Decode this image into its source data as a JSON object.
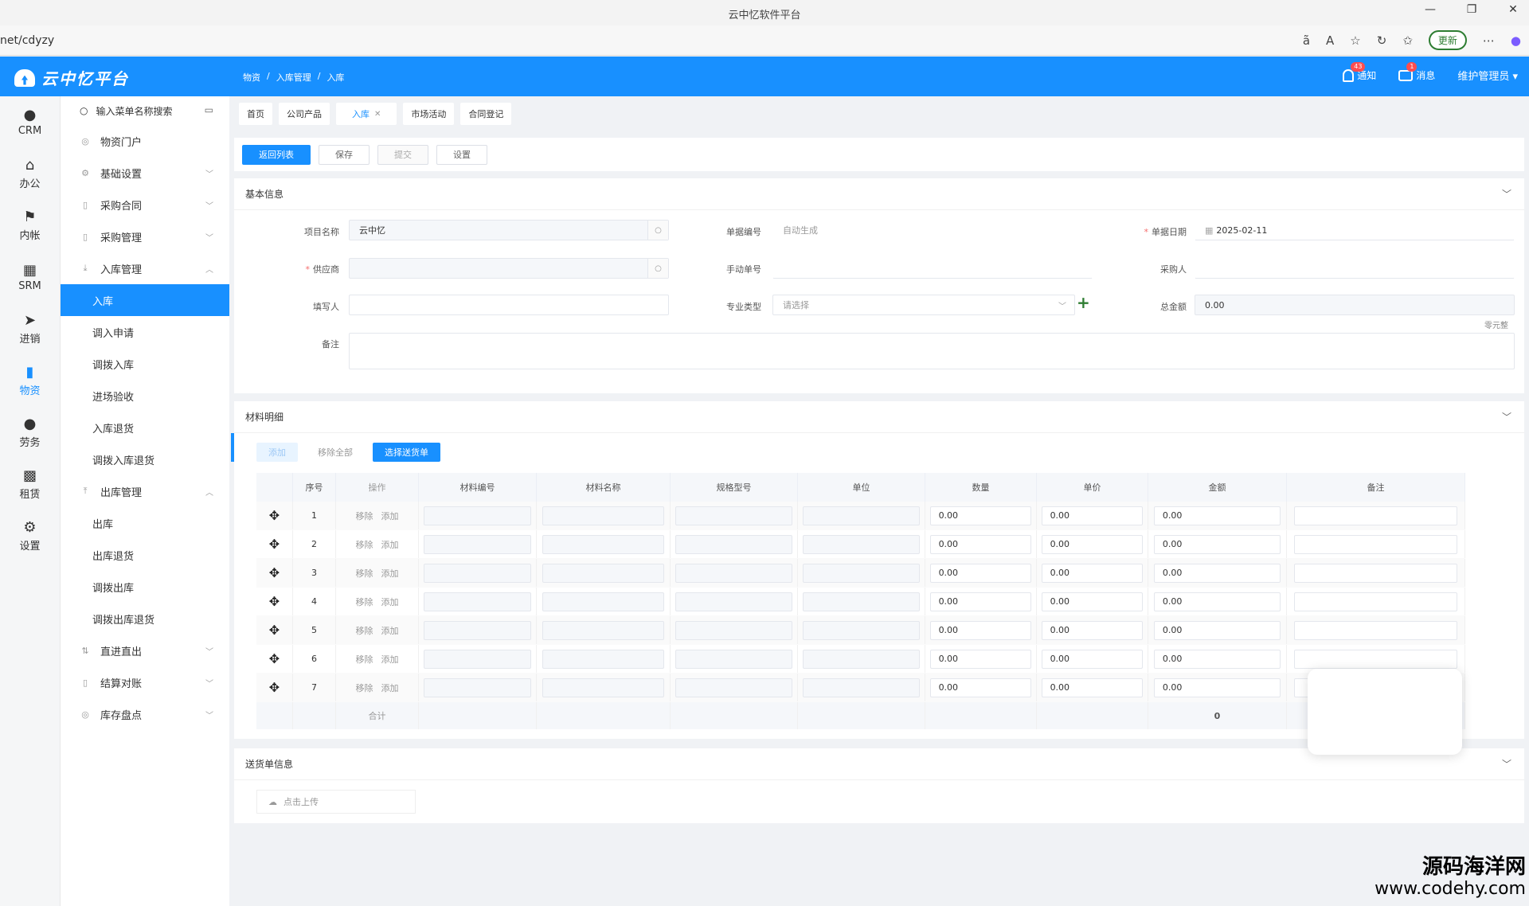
{
  "browser": {
    "title": "云中忆软件平台",
    "url": "net/cdyzy",
    "update_label": "更新"
  },
  "header": {
    "logo": "云中忆平台",
    "breadcrumb": [
      "物资",
      "/",
      "入库管理",
      "/",
      "入库"
    ],
    "notify_label": "通知",
    "notify_count": "43",
    "message_label": "消息",
    "message_count": "1",
    "user": "维护管理员 ▾"
  },
  "iconbar": [
    {
      "label": "CRM",
      "icon": "user-icon"
    },
    {
      "label": "办公",
      "icon": "home-icon"
    },
    {
      "label": "内帐",
      "icon": "flag-icon"
    },
    {
      "label": "SRM",
      "icon": "grid-icon"
    },
    {
      "label": "进销",
      "icon": "send-icon"
    },
    {
      "label": "物资",
      "icon": "book-icon"
    },
    {
      "label": "劳务",
      "icon": "person-icon"
    },
    {
      "label": "租赁",
      "icon": "apps-icon"
    },
    {
      "label": "设置",
      "icon": "gear-icon"
    }
  ],
  "menu": {
    "search_placeholder": "输入菜单名称搜索",
    "items": [
      {
        "label": "物资门户"
      },
      {
        "label": "基础设置"
      },
      {
        "label": "采购合同"
      },
      {
        "label": "采购管理"
      },
      {
        "label": "入库管理"
      },
      {
        "label": "入库"
      },
      {
        "label": "调入申请"
      },
      {
        "label": "调拨入库"
      },
      {
        "label": "进场验收"
      },
      {
        "label": "入库退货"
      },
      {
        "label": "调拨入库退货"
      },
      {
        "label": "出库管理"
      },
      {
        "label": "出库"
      },
      {
        "label": "出库退货"
      },
      {
        "label": "调拨出库"
      },
      {
        "label": "调拨出库退货"
      },
      {
        "label": "直进直出"
      },
      {
        "label": "结算对账"
      },
      {
        "label": "库存盘点"
      }
    ]
  },
  "tabs": [
    "首页",
    "公司产品",
    "入库",
    "市场活动",
    "合同登记"
  ],
  "actions": {
    "back": "返回列表",
    "save": "保存",
    "submit": "提交",
    "settings": "设置"
  },
  "basic": {
    "title": "基本信息",
    "project_label": "项目名称",
    "project_value": "云中忆",
    "docno_label": "单据编号",
    "docno_value": "自动生成",
    "date_label": "单据日期",
    "date_value": "2025-02-11",
    "supplier_label": "供应商",
    "manual_label": "手动单号",
    "buyer_label": "采购人",
    "filler_label": "填写人",
    "type_label": "专业类型",
    "type_placeholder": "请选择",
    "total_label": "总金额",
    "total_value": "0.00",
    "total_words": "零元整",
    "remark_label": "备注"
  },
  "materials": {
    "title": "材料明细",
    "add": "添加",
    "remove_all": "移除全部",
    "select_delivery": "选择送货单",
    "columns": [
      "序号",
      "操作",
      "材料编号",
      "材料名称",
      "规格型号",
      "单位",
      "数量",
      "单价",
      "金额",
      "备注"
    ],
    "row_remove": "移除",
    "row_add": "添加",
    "rows": [
      {
        "no": "1",
        "qty": "0.00",
        "price": "0.00",
        "amount": "0.00"
      },
      {
        "no": "2",
        "qty": "0.00",
        "price": "0.00",
        "amount": "0.00"
      },
      {
        "no": "3",
        "qty": "0.00",
        "price": "0.00",
        "amount": "0.00"
      },
      {
        "no": "4",
        "qty": "0.00",
        "price": "0.00",
        "amount": "0.00"
      },
      {
        "no": "5",
        "qty": "0.00",
        "price": "0.00",
        "amount": "0.00"
      },
      {
        "no": "6",
        "qty": "0.00",
        "price": "0.00",
        "amount": "0.00"
      },
      {
        "no": "7",
        "qty": "0.00",
        "price": "0.00",
        "amount": "0.00"
      }
    ],
    "sum_label": "合计",
    "sum_value": "0"
  },
  "delivery": {
    "title": "送货单信息",
    "upload": "点击上传"
  },
  "watermark": {
    "line1": "源码海洋网",
    "line2": "www.codehy.com"
  }
}
